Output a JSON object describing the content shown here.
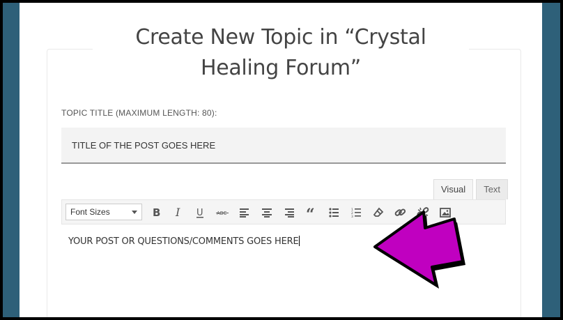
{
  "page": {
    "title": "Create New Topic in “Crystal Healing Forum”"
  },
  "form": {
    "title_label": "TOPIC TITLE (MAXIMUM LENGTH: 80):",
    "title_value": "TITLE OF THE POST GOES HERE"
  },
  "editor": {
    "tabs": [
      {
        "label": "Visual",
        "active": true
      },
      {
        "label": "Text",
        "active": false
      }
    ],
    "font_size_select": "Font Sizes",
    "toolbar_icons": [
      "bold-icon",
      "italic-icon",
      "underline-icon",
      "strikethrough-icon",
      "align-left-icon",
      "align-center-icon",
      "align-right-icon",
      "blockquote-icon",
      "bullet-list-icon",
      "numbered-list-icon",
      "eraser-icon",
      "link-icon",
      "unlink-icon",
      "image-icon"
    ],
    "body_text": "YOUR POST OR QUESTIONS/COMMENTS GOES HERE"
  },
  "annotation": {
    "arrow_color": "#c000c0"
  },
  "colors": {
    "frame_border": "#2e6079"
  }
}
